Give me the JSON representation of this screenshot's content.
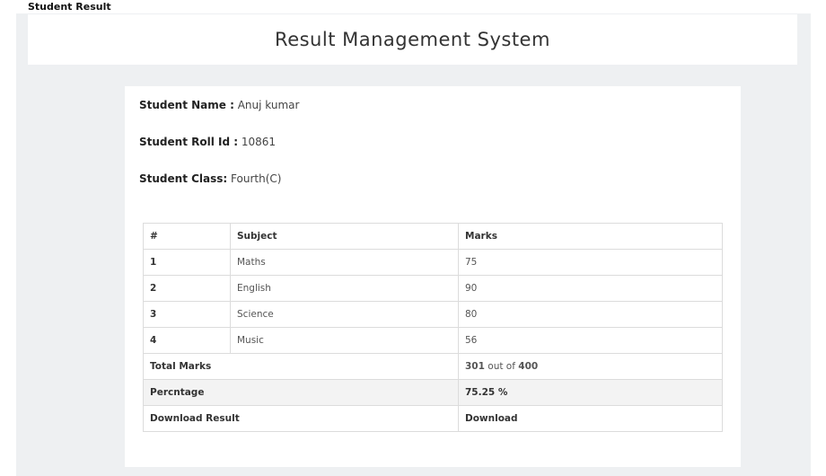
{
  "page": {
    "label": "Student Result"
  },
  "header": {
    "title": "Result Management System"
  },
  "student": {
    "name_label": "Student Name :",
    "name_value": "Anuj kumar",
    "roll_label": "Student Roll Id :",
    "roll_value": "10861",
    "class_label": "Student Class:",
    "class_value": "Fourth(C)"
  },
  "table": {
    "headers": {
      "index": "#",
      "subject": "Subject",
      "marks": "Marks"
    },
    "rows": [
      {
        "index": "1",
        "subject": "Maths",
        "marks": "75"
      },
      {
        "index": "2",
        "subject": "English",
        "marks": "90"
      },
      {
        "index": "3",
        "subject": "Science",
        "marks": "80"
      },
      {
        "index": "4",
        "subject": "Music",
        "marks": "56"
      }
    ],
    "total": {
      "label": "Total Marks",
      "obtained": "301",
      "out_of_text": "out of",
      "max": "400"
    },
    "percentage": {
      "label": "Percntage",
      "value": "75.25 %"
    },
    "download": {
      "label": "Download Result",
      "link": "Download"
    }
  }
}
